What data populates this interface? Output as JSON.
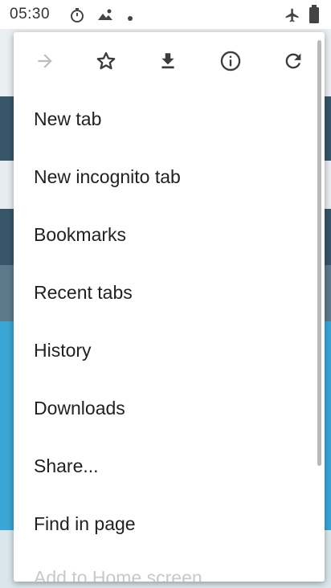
{
  "status_bar": {
    "time": "05:30"
  },
  "toolbar": {
    "buttons": [
      {
        "name": "forward-icon",
        "enabled": false
      },
      {
        "name": "star-icon",
        "enabled": true
      },
      {
        "name": "download-icon",
        "enabled": true
      },
      {
        "name": "info-icon",
        "enabled": true
      },
      {
        "name": "reload-icon",
        "enabled": true
      }
    ]
  },
  "menu": {
    "items": [
      {
        "label": "New tab"
      },
      {
        "label": "New incognito tab"
      },
      {
        "label": "Bookmarks"
      },
      {
        "label": "Recent tabs"
      },
      {
        "label": "History"
      },
      {
        "label": "Downloads"
      },
      {
        "label": "Share..."
      },
      {
        "label": "Find in page"
      },
      {
        "label": "Add to Home screen"
      }
    ]
  },
  "colors": {
    "menu_bg": "#ffffff",
    "text": "#202124",
    "icon": "#3c3c3c",
    "disabled_icon": "#bdbdbd"
  }
}
